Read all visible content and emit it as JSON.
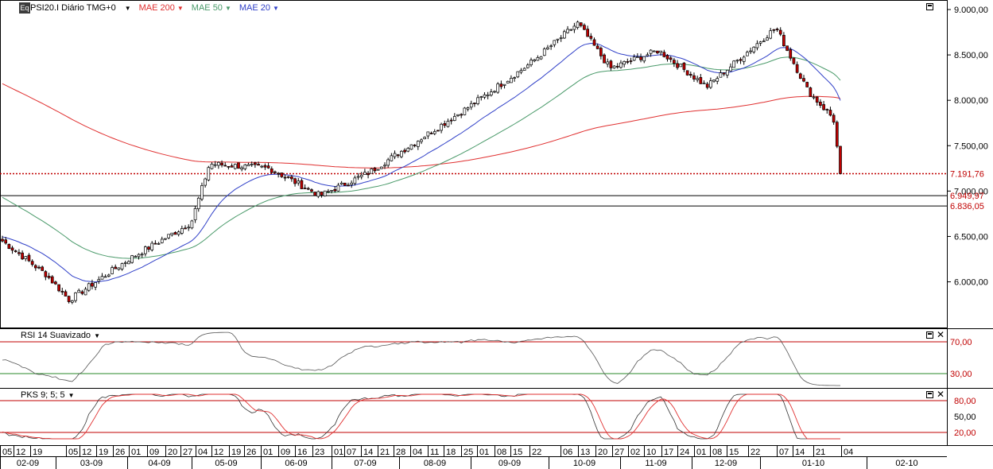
{
  "legend": {
    "symbol": "PSI20.I Diário TMG+0",
    "mae200": "MAE 200",
    "mae50": "MAE 50",
    "mae20": "MAE 20",
    "colors": {
      "mae200": "#e03030",
      "mae50": "#4a9a6a",
      "mae20": "#3040c8",
      "up": "#ffffff",
      "down": "#c00000"
    }
  },
  "price_axis": {
    "ticks": [
      "9.000,00",
      "8.500,00",
      "8.000,00",
      "7.500,00",
      "7.000,00",
      "6.500,00",
      "6.000,00"
    ],
    "markers": [
      {
        "label": "7.191,76",
        "value": 7191.76,
        "style": "dotted",
        "color": "#c00000"
      },
      {
        "label": "6.949,97",
        "value": 6949.97,
        "style": "solid",
        "color": "#c00000"
      },
      {
        "label": "6.836,05",
        "value": 6836.05,
        "style": "solid",
        "color": "#c00000"
      }
    ]
  },
  "rsi": {
    "title": "RSI 14 Suavizado",
    "levels": [
      "70,00",
      "30,00"
    ],
    "ticks": [
      "70,00",
      "30,00"
    ]
  },
  "pks": {
    "title": "PKS 9; 5; 5",
    "ticks": [
      "80,00",
      "50,00",
      "20,00"
    ]
  },
  "time_axis": {
    "days": [
      "05",
      "12",
      "19",
      "05",
      "12",
      "19",
      "26",
      "01",
      "09",
      "20",
      "27",
      "04",
      "12",
      "19",
      "26",
      "01",
      "09",
      "16",
      "23",
      "01",
      "07",
      "14",
      "21",
      "28",
      "04",
      "11",
      "18",
      "25",
      "01",
      "08",
      "15",
      "22",
      "06",
      "13",
      "20",
      "27",
      "02",
      "10",
      "17",
      "24",
      "01",
      "08",
      "15",
      "22",
      "07",
      "14",
      "21",
      "04"
    ],
    "months": [
      "02-09",
      "03-09",
      "04-09",
      "05-09",
      "06-09",
      "07-09",
      "08-09",
      "09-09",
      "10-09",
      "11-09",
      "12-09",
      "01-10",
      "02-10"
    ]
  },
  "chart_data": {
    "type": "candlestick",
    "title": "PSI20.I Diário TMG+0",
    "ylim": [
      5700,
      9100
    ],
    "price_samples": [
      {
        "date": "2009-02-05",
        "close": 6450
      },
      {
        "date": "2009-02-24",
        "close": 6080
      },
      {
        "date": "2009-03-06",
        "close": 5800
      },
      {
        "date": "2009-04-01",
        "close": 6250
      },
      {
        "date": "2009-04-28",
        "close": 6650
      },
      {
        "date": "2009-05-06",
        "close": 7300
      },
      {
        "date": "2009-06-01",
        "close": 7250
      },
      {
        "date": "2009-06-23",
        "close": 6950
      },
      {
        "date": "2009-07-14",
        "close": 7200
      },
      {
        "date": "2009-08-25",
        "close": 7900
      },
      {
        "date": "2009-09-22",
        "close": 8400
      },
      {
        "date": "2009-10-13",
        "close": 8850
      },
      {
        "date": "2009-10-27",
        "close": 8350
      },
      {
        "date": "2009-11-17",
        "close": 8550
      },
      {
        "date": "2009-12-08",
        "close": 8150
      },
      {
        "date": "2010-01-07",
        "close": 8800
      },
      {
        "date": "2010-01-21",
        "close": 8100
      },
      {
        "date": "2010-02-01",
        "close": 7800
      },
      {
        "date": "2010-02-04",
        "close": 7191.76
      }
    ],
    "series": [
      {
        "name": "MAE 200",
        "color": "#e03030"
      },
      {
        "name": "MAE 50",
        "color": "#4a9a6a"
      },
      {
        "name": "MAE 20",
        "color": "#3040c8"
      }
    ]
  }
}
